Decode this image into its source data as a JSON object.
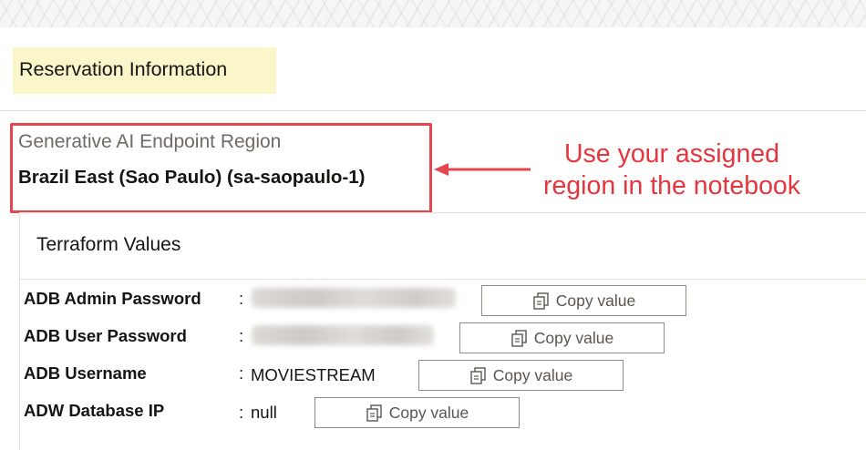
{
  "section": {
    "title": "Reservation Information"
  },
  "region": {
    "label": "Generative AI Endpoint Region",
    "value": "Brazil East (Sao Paulo) (sa-saopaulo-1)"
  },
  "annotation": {
    "line1": "Use your assigned",
    "line2": "region in the notebook",
    "color": "#e5363f"
  },
  "terraform": {
    "title": "Terraform Values",
    "rows": [
      {
        "label": "ADB Admin Password",
        "value": "",
        "masked": true,
        "button": "Copy value"
      },
      {
        "label": "ADB User Password",
        "value": "",
        "masked": true,
        "button": "Copy value"
      },
      {
        "label": "ADB Username",
        "value": "MOVIESTREAM",
        "masked": false,
        "button": "Copy value"
      },
      {
        "label": "ADW Database IP",
        "value": "null",
        "masked": false,
        "button": "Copy value"
      }
    ],
    "colon": ":"
  },
  "icons": {
    "copy": "copy-icon",
    "arrow": "arrow-left-icon"
  },
  "colors": {
    "highlight": "#e5454d",
    "title_bg": "#faf6c9"
  }
}
